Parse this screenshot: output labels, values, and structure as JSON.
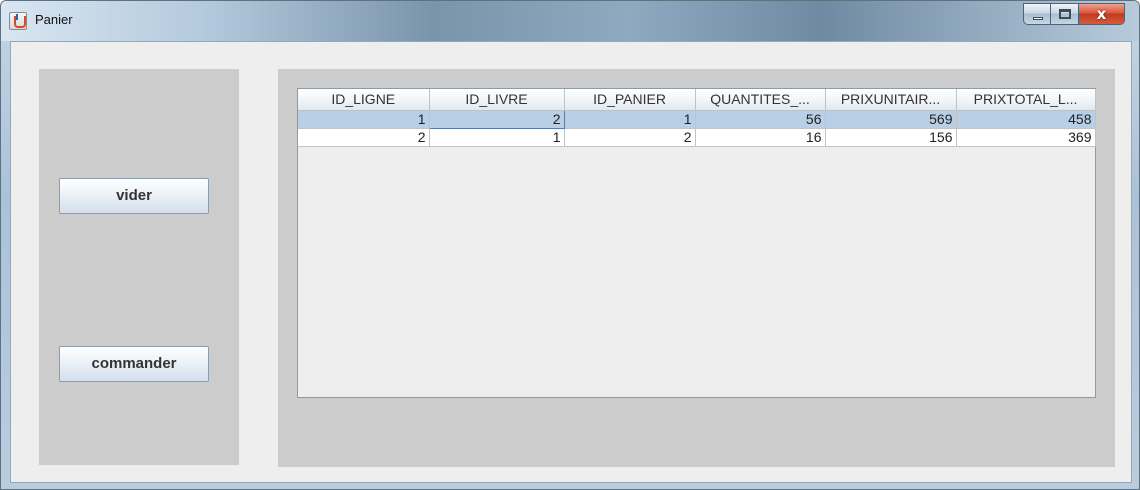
{
  "window": {
    "title": "Panier",
    "close_glyph": "x",
    "icons": [
      "java-cup-icon",
      "minimize-icon",
      "maximize-icon",
      "close-icon"
    ]
  },
  "actions": {
    "vider_label": "vider",
    "commander_label": "commander"
  },
  "table": {
    "columns": [
      "ID_LIGNE",
      "ID_LIVRE",
      "ID_PANIER",
      "QUANTITES_...",
      "PRIXUNITAIR...",
      "PRIXTOTAL_L..."
    ],
    "rows": [
      [
        "1",
        "2",
        "1",
        "56",
        "569",
        "458"
      ],
      [
        "2",
        "1",
        "2",
        "16",
        "156",
        "369"
      ]
    ],
    "selected_row": 0
  },
  "colors": {
    "selection": "#b8cfe5",
    "panel": "#cccccc",
    "client": "#eeeeee"
  }
}
